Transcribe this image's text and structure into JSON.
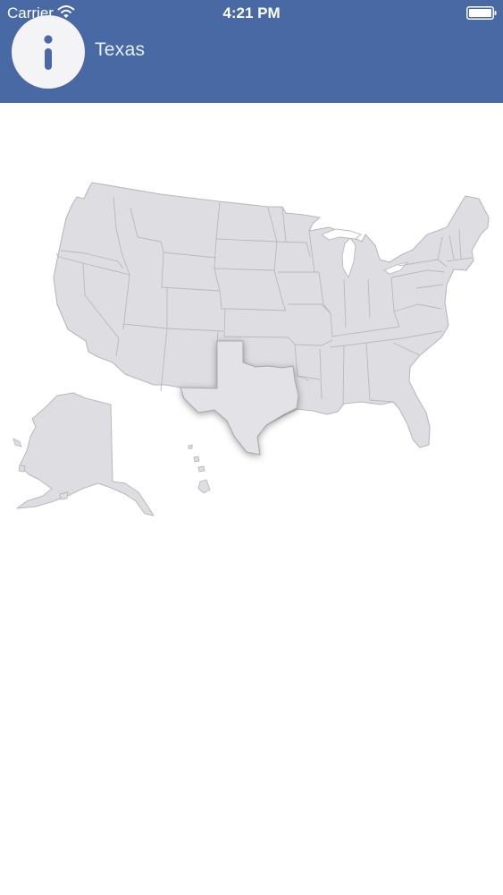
{
  "status_bar": {
    "carrier": "Carrier",
    "time": "4:21 PM",
    "wifi_icon": "wifi-icon",
    "battery_icon": "battery-icon"
  },
  "header": {
    "title": "Texas",
    "info_icon": "info-icon"
  },
  "map": {
    "selected_state": "Texas",
    "colors": {
      "header": "#4869a3",
      "state_fill": "#dedde1",
      "state_border": "#b9b8bd",
      "selected_fill": "#e3e2e6"
    }
  }
}
